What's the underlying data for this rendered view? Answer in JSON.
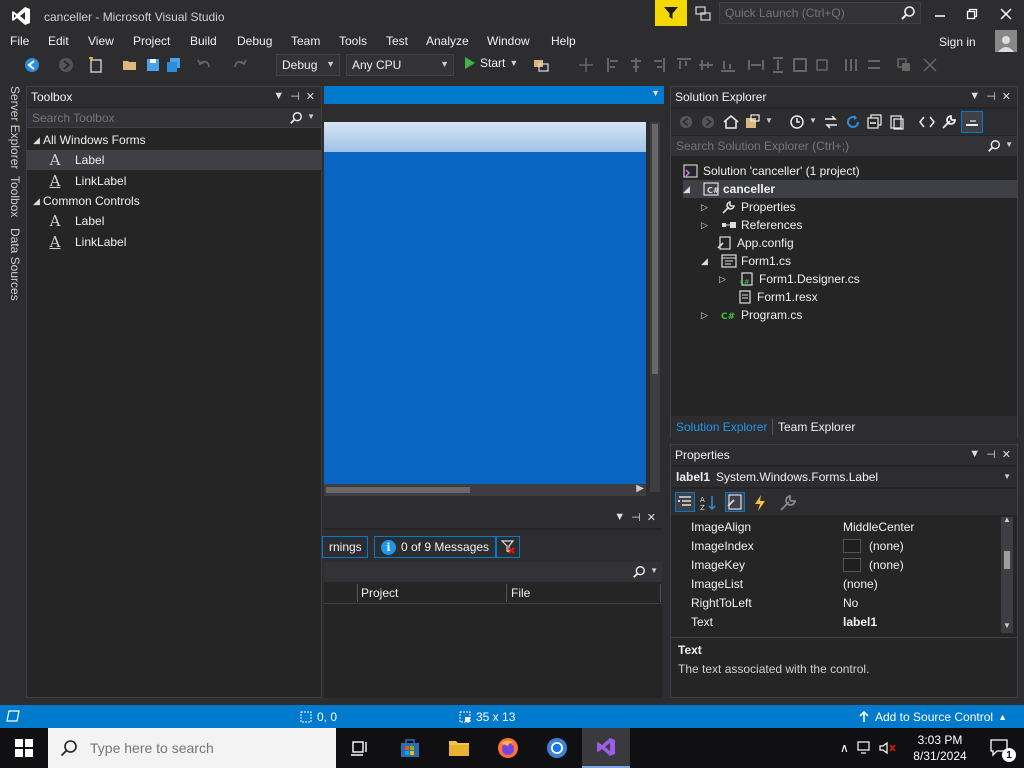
{
  "window": {
    "title": "canceller - Microsoft Visual Studio",
    "quick_launch_placeholder": "Quick Launch (Ctrl+Q)"
  },
  "menu": [
    "File",
    "Edit",
    "View",
    "Project",
    "Build",
    "Debug",
    "Team",
    "Tools",
    "Test",
    "Analyze",
    "Window",
    "Help"
  ],
  "account": {
    "signin_label": "Sign in"
  },
  "toolbar": {
    "config": "Debug",
    "platform": "Any CPU",
    "start_label": "Start"
  },
  "side_tabs": [
    "Server Explorer",
    "Toolbox",
    "Data Sources"
  ],
  "toolbox": {
    "title": "Toolbox",
    "search_placeholder": "Search Toolbox",
    "groups": [
      {
        "name": "All Windows Forms",
        "items": [
          "Label",
          "LinkLabel"
        ]
      },
      {
        "name": "Common Controls",
        "items": [
          "Label",
          "LinkLabel"
        ]
      }
    ],
    "selected_item": "Label"
  },
  "error_list": {
    "warnings_label": "rnings",
    "messages_label": "0 of 9 Messages",
    "columns": [
      "Project",
      "File"
    ]
  },
  "solution_explorer": {
    "title": "Solution Explorer",
    "search_placeholder": "Search Solution Explorer (Ctrl+;)",
    "solution_label": "Solution 'canceller' (1 project)",
    "project": "canceller",
    "nodes": {
      "properties": "Properties",
      "references": "References",
      "appconfig": "App.config",
      "form1": "Form1.cs",
      "designer": "Form1.Designer.cs",
      "resx": "Form1.resx",
      "program": "Program.cs"
    },
    "tabs": [
      "Solution Explorer",
      "Team Explorer"
    ]
  },
  "properties": {
    "title": "Properties",
    "object_name": "label1",
    "object_type": "System.Windows.Forms.Label",
    "rows": [
      {
        "name": "ImageAlign",
        "value": "MiddleCenter"
      },
      {
        "name": "ImageIndex",
        "value": "(none)"
      },
      {
        "name": "ImageKey",
        "value": "(none)"
      },
      {
        "name": "ImageList",
        "value": "(none)"
      },
      {
        "name": "RightToLeft",
        "value": "No"
      },
      {
        "name": "Text",
        "value": "label1"
      }
    ],
    "desc_title": "Text",
    "desc_text": "The text associated with the control."
  },
  "status_bar": {
    "position": "0, 0",
    "size": "35 x 13",
    "source_control": "Add to Source Control"
  },
  "taskbar": {
    "search_placeholder": "Type here to search",
    "time": "3:03 PM",
    "date": "8/31/2024",
    "notification_count": "1"
  },
  "colors": {
    "accent": "#007acc",
    "form_body": "#0a64c2",
    "filter_yellow": "#f5d800"
  }
}
